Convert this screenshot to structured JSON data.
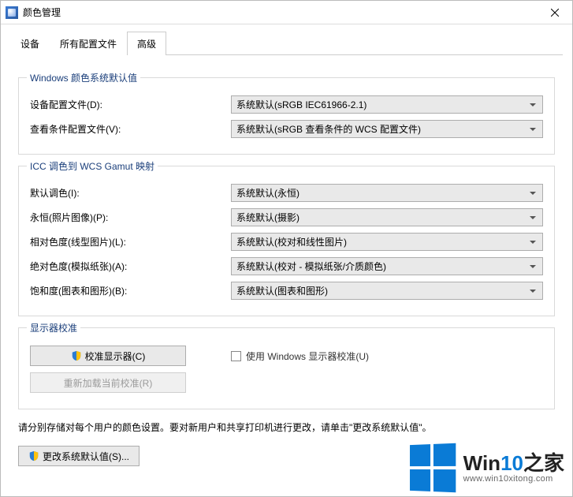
{
  "window": {
    "title": "颜色管理",
    "close_glyph": "×"
  },
  "tabs": {
    "devices": "设备",
    "profiles": "所有配置文件",
    "advanced": "高级"
  },
  "groups": {
    "defaults": {
      "legend": "Windows 颜色系统默认值",
      "device_profile_label": "设备配置文件(D):",
      "device_profile_value": "系统默认(sRGB IEC61966-2.1)",
      "viewing_profile_label": "查看条件配置文件(V):",
      "viewing_profile_value": "系统默认(sRGB 查看条件的 WCS 配置文件)"
    },
    "gamut": {
      "legend": "ICC 调色到 WCS Gamut 映射",
      "default_intent_label": "默认调色(I):",
      "default_intent_value": "系统默认(永恒)",
      "perceptual_label": "永恒(照片图像)(P):",
      "perceptual_value": "系统默认(摄影)",
      "relative_label": "相对色度(线型图片)(L):",
      "relative_value": "系统默认(校对和线性图片)",
      "absolute_label": "绝对色度(模拟纸张)(A):",
      "absolute_value": "系统默认(校对 - 模拟纸张/介质颜色)",
      "saturation_label": "饱和度(图表和图形)(B):",
      "saturation_value": "系统默认(图表和图形)"
    },
    "calibration": {
      "legend": "显示器校准",
      "calibrate_btn": "校准显示器(C)",
      "reload_btn": "重新加载当前校准(R)",
      "use_checkbox": "使用 Windows 显示器校准(U)"
    }
  },
  "note": "请分别存储对每个用户的颜色设置。要对新用户和共享打印机进行更改，请单击\"更改系统默认值\"。",
  "change_defaults_btn": "更改系统默认值(S)...",
  "watermark": {
    "brand_a": "Win",
    "brand_b": "10",
    "brand_c": "之家",
    "url": "www.win10xitong.com"
  }
}
